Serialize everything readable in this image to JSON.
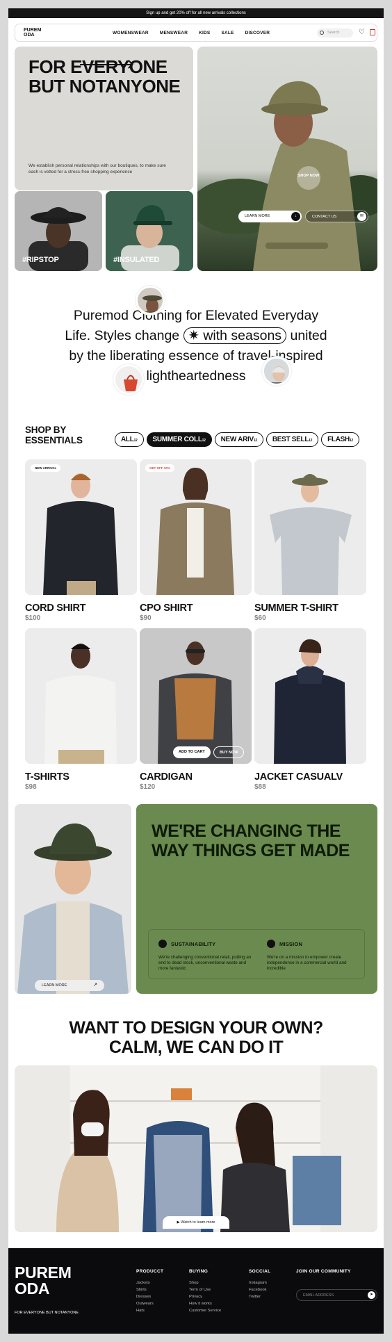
{
  "announcement": "Sign up and get 20% off for all new arrivals collections",
  "nav": {
    "logo": "PUREM ODA",
    "links": [
      "WOMENSWEAR",
      "MENSWEAR",
      "KIDS",
      "SALE",
      "DISCOVER"
    ],
    "search_placeholder": "Search"
  },
  "hero": {
    "title": "FOR EVERYONE BUT NOTANYONE",
    "description": "We establish personal relationships with our boutiques, to make sure each is vetted for a stress-free shopping experience",
    "tile1_tag": "#RIPSTOP",
    "tile2_tag": "#INSULATED",
    "shop_now": "SHOP NOW",
    "learn_more": "LEARN MORE",
    "contact_us": "CONTACT US"
  },
  "manifesto": {
    "line1": "Puremod Clothing for Elevated Everyday",
    "line2a": "Life. Styles change",
    "line2_pill": "with seasons",
    "line2b": "united",
    "line3": "by the liberating essence of travel-inspired",
    "line4": "lightheartedness"
  },
  "essentials": {
    "title": "SHOP BY ESSENTIALS",
    "filters": [
      {
        "label": "ALL",
        "count": "12",
        "active": false
      },
      {
        "label": "SUMMER COLL",
        "count": "12",
        "active": true
      },
      {
        "label": "NEW ARIV",
        "count": "12",
        "active": false
      },
      {
        "label": "BEST SELL",
        "count": "12",
        "active": false
      },
      {
        "label": "FLASH",
        "count": "12",
        "active": false
      }
    ],
    "products": [
      {
        "name": "CORD SHIRT",
        "price": "$100",
        "badge": "NEW ARRIVAL"
      },
      {
        "name": "CPO SHIRT",
        "price": "$90",
        "badge": "GET OFF 10%"
      },
      {
        "name": "SUMMER T-SHIRT",
        "price": "$60",
        "badge": ""
      },
      {
        "name": "T-SHIRTS",
        "price": "$98",
        "badge": ""
      },
      {
        "name": "CARDIGAN",
        "price": "$120",
        "badge": ""
      },
      {
        "name": "JACKET CASUALV",
        "price": "$88",
        "badge": ""
      }
    ],
    "add_to_cart": "ADD TO CART",
    "buy_now": "BUY NOW"
  },
  "mission": {
    "learn_more": "LEARN MORE",
    "headline": "WE'RE CHANGING THE WAY THINGS GET MADE",
    "sustainability_title": "SUSTAINABILITY",
    "sustainability_text": "We're challenging conventional retail, putting an end to dead stock, unconventional waste and more fantastic",
    "mission_title": "MISSION",
    "mission_text": "We're on a mission to empower create independence in a commercial world and incredible"
  },
  "design": {
    "headline_1": "WANT TO DESIGN YOUR OWN?",
    "headline_2": "CALM, WE CAN DO IT",
    "watch": "Watch to learn more"
  },
  "footer": {
    "logo": "PUREM ODA",
    "tagline": "FOR EVERYONE BUT NOTANYONE",
    "product_title": "PRODUCCT",
    "product_items": [
      "Jackets",
      "Shirts",
      "Dresses",
      "Outwears",
      "Hats"
    ],
    "buying_title": "BUYING",
    "buying_items": [
      "Shop",
      "Term of Use",
      "Privacy",
      "How it works",
      "Customer Service"
    ],
    "social_title": "SOCCIAL",
    "social_items": [
      "Instagram",
      "Facebook",
      "Twitter"
    ],
    "community_title": "JOIN OUR COMMUNITY",
    "email_placeholder": "EMAIL ADDRESS"
  }
}
